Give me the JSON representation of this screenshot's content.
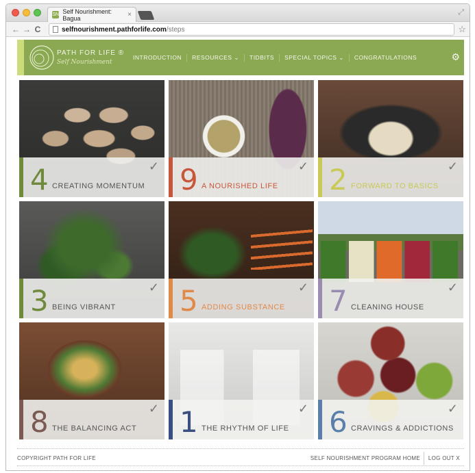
{
  "browser": {
    "tab_title": "Self Nourishment: Bagua",
    "tab_close": "×",
    "favicon": "SN",
    "url_host": "selfnourishment.pathforlife.com",
    "url_path": "/steps",
    "back": "←",
    "forward": "→",
    "reload": "C",
    "star": "☆",
    "resize": "⤢"
  },
  "header": {
    "brand": "PATH FOR LIFE ®",
    "subbrand": "Self Nourishment",
    "nav": [
      "INTRODUCTION",
      "RESOURCES ⌄",
      "TIDBITS",
      "SPECIAL TOPICS ⌄",
      "CONGRATULATIONS"
    ],
    "settings": "⚙"
  },
  "tiles": [
    {
      "num": "4",
      "title": "CREATING MOMENTUM",
      "color": "#6f8a3d",
      "check": "✓"
    },
    {
      "num": "9",
      "title": "A NOURISHED LIFE",
      "color": "#c8563b",
      "check": "✓"
    },
    {
      "num": "2",
      "title": "FORWARD TO BASICS",
      "color": "#c9c955",
      "check": "✓"
    },
    {
      "num": "3",
      "title": "BEING VIBRANT",
      "color": "#6f8a3d",
      "check": "✓"
    },
    {
      "num": "5",
      "title": "ADDING SUBSTANCE",
      "color": "#e08a4a",
      "check": "✓"
    },
    {
      "num": "7",
      "title": "CLEANING HOUSE",
      "color": "#9a8bb1",
      "check": "✓"
    },
    {
      "num": "8",
      "title": "THE BALANCING ACT",
      "color": "#7a5a52",
      "check": "✓"
    },
    {
      "num": "1",
      "title": "THE RHYTHM OF LIFE",
      "color": "#3a4f80",
      "check": "✓"
    },
    {
      "num": "6",
      "title": "CRAVINGS & ADDICTIONS",
      "color": "#5a7fa8",
      "check": "✓"
    }
  ],
  "footer": {
    "copyright": "COPYRIGHT PATH FOR LIFE",
    "program_home": "SELF NOURISHMENT PROGRAM HOME",
    "logout": "LOG OUT X"
  }
}
